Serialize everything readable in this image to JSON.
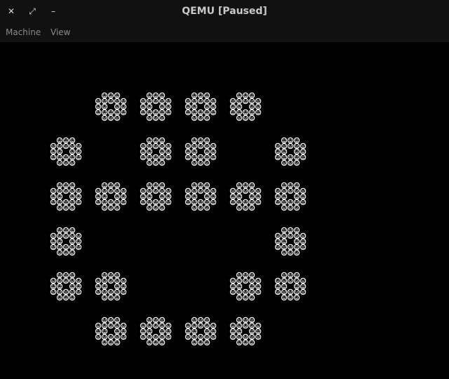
{
  "window": {
    "title": "QEMU [Paused]",
    "controls": {
      "close_glyph": "✕",
      "restore_glyph": "⤢",
      "minimize_glyph": "–"
    }
  },
  "menubar": {
    "items": [
      "Machine",
      "View"
    ]
  },
  "screen": {
    "background": "#000000",
    "glyph_color": "#ffffff",
    "glyph": "☺",
    "grid_rows": 6,
    "grid_cols": 6,
    "occupied": [
      [
        false,
        true,
        true,
        true,
        true,
        false
      ],
      [
        true,
        false,
        true,
        true,
        false,
        true
      ],
      [
        true,
        true,
        true,
        true,
        true,
        true
      ],
      [
        true,
        false,
        false,
        false,
        false,
        true
      ],
      [
        true,
        true,
        false,
        false,
        true,
        true
      ],
      [
        false,
        true,
        true,
        true,
        true,
        false
      ]
    ],
    "cell_pattern": [
      [
        false,
        true,
        true,
        true,
        false
      ],
      [
        true,
        true,
        true,
        true,
        true
      ],
      [
        true,
        true,
        false,
        true,
        true
      ],
      [
        true,
        true,
        true,
        true,
        true
      ],
      [
        false,
        true,
        true,
        true,
        false
      ]
    ]
  }
}
